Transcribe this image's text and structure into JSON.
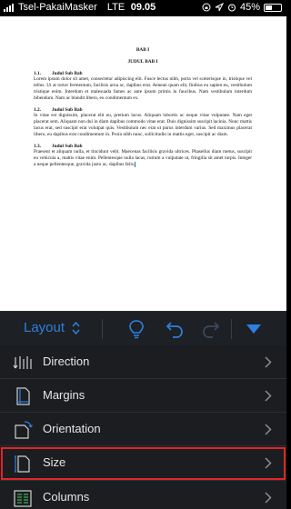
{
  "status": {
    "carrier": "Tsel-PakaiMasker",
    "network": "LTE",
    "time": "09.05",
    "battery": "45%",
    "battery_level": 0.45
  },
  "document": {
    "chapter": "BAB I",
    "chapter_title": "JUDUL BAB I",
    "sections": [
      {
        "number": "1.1.",
        "heading": "Judul Sub Bab",
        "body": "Lorem ipsum dolor sit amet, consectetur adipiscing elit. Fusce lectus nibh, porta vel scelerisque in, tristique vel tellus. Ut at tortor fermentum, facilisis urna ac, dapibus erat. Aenean quam elit, finibus eu sapien eu, vestibulum tristique enim. Interdum et malesuada fames ac ante ipsum primis in faucibus. Nam vestibulum interdum bibendum. Nam ac blandit libero, eu condimentum ex."
      },
      {
        "number": "1.2.",
        "heading": "Judul Sub Bab",
        "body": "In vitae est dignissim, placerat elit eu, pretium lacus. Aliquam lobortis ac neque vitae vulputate. Nam eget placerat sem. Aliquam non dui in diam dapibus commodo vitae erat. Duis dignissim suscipit lacinia. Nunc mattis lacus erat, sed suscipit erat volutpat quis. Vestibulum nec erat ut purus interdum varius. Sed maximus placerat libero, eu dapibus erat condimentum in. Proin nibh nunc, sollicitudin in mattis eget, suscipit ac diam."
      },
      {
        "number": "1.3.",
        "heading": "Judul Sub Bab",
        "body": "Praesent et aliquam nulla, et tincidunt velit. Maecenas facilisis gravida ultrices. Phasellus diam metus, suscipit eu vehicula a, mattis vitae enim. Pellentesque nulla lacus, rutrum a vulputate ut, fringilla sit amet turpis. Integer a neque pellentesque, gravida justo ac, dapibus felis."
      }
    ]
  },
  "toolbar": {
    "title": "Layout"
  },
  "menu": {
    "items": [
      {
        "label": "Direction",
        "icon": "text-direction-icon"
      },
      {
        "label": "Margins",
        "icon": "margins-icon"
      },
      {
        "label": "Orientation",
        "icon": "orientation-icon"
      },
      {
        "label": "Size",
        "icon": "page-size-icon",
        "selected": true
      },
      {
        "label": "Columns",
        "icon": "columns-icon"
      }
    ]
  },
  "colors": {
    "accent": "#2f7fe0",
    "highlight": "#e0252b",
    "panel": "#1b1d20"
  }
}
